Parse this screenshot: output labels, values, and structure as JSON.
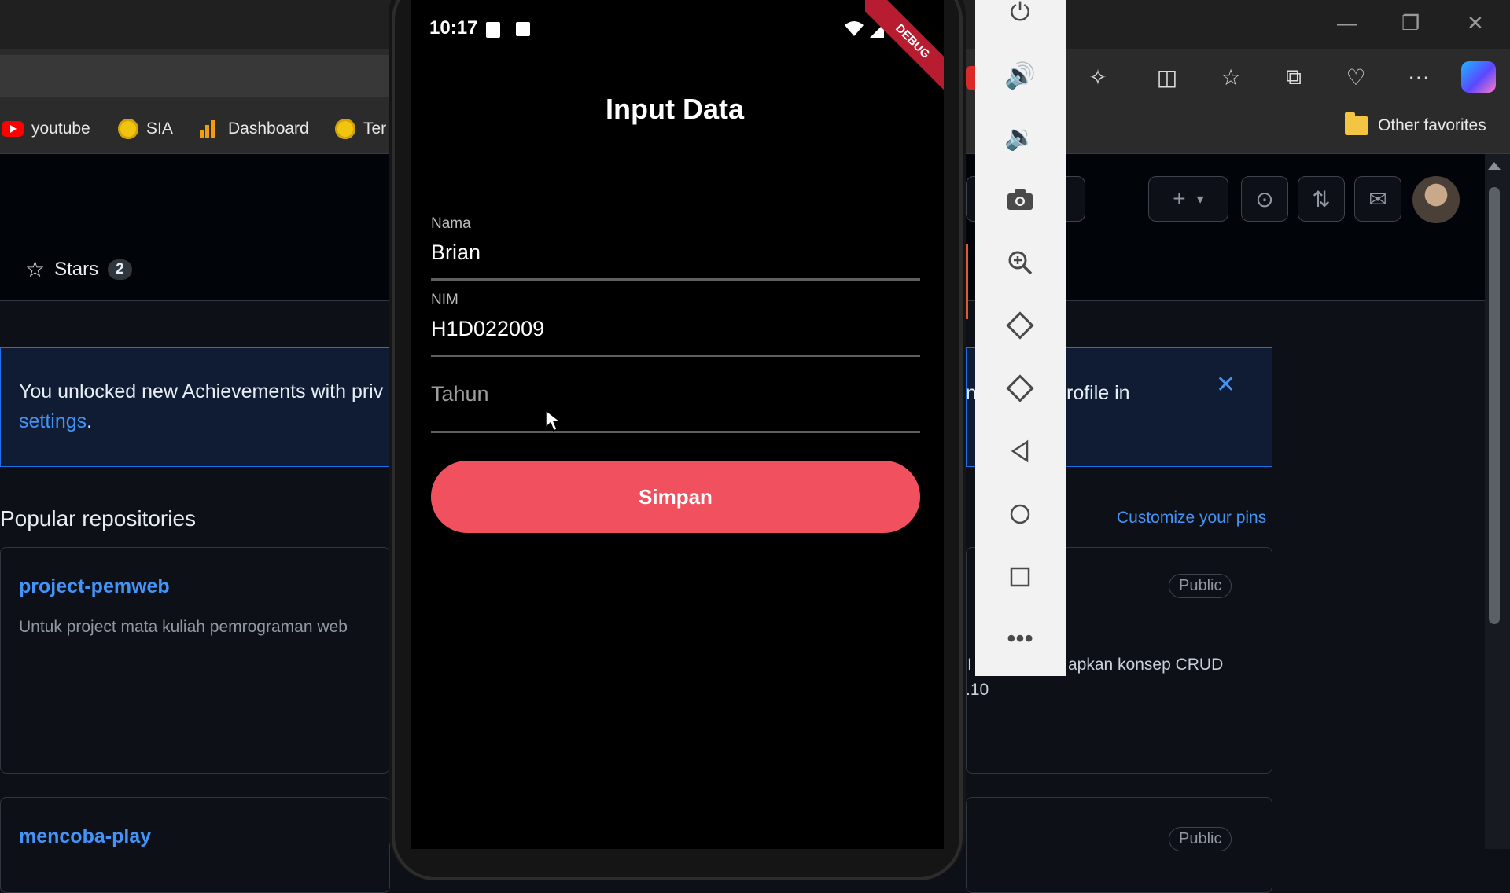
{
  "browser": {
    "bookmarks": [
      {
        "label": "youtube"
      },
      {
        "label": "SIA"
      },
      {
        "label": "Dashboard"
      },
      {
        "label": "Ter"
      }
    ],
    "other_favorites": "Other favorites"
  },
  "github": {
    "stars_label": "Stars",
    "stars_count": "2",
    "banner_line1": "You unlocked new Achievements with priv",
    "banner_link": "settings",
    "banner_dot": ".",
    "banner_right_a": "ns",
    "banner_right_b": "rofile in",
    "popular_title": "Popular repositories",
    "customize_pins": "Customize your pins",
    "repos": [
      {
        "name": "project-pemweb",
        "desc": "Untuk project mata kuliah pemrograman web"
      },
      {
        "name": "mencoba-play",
        "desc": ""
      }
    ],
    "right_card_text": "apkan konsep CRUD",
    "right_card_text2": ".10",
    "right_card_i": "I",
    "public_badge": "Public"
  },
  "phone": {
    "time": "10:17",
    "debug_banner": "DEBUG",
    "title": "Input Data",
    "fields": [
      {
        "label": "Nama",
        "value": "Brian"
      },
      {
        "label": "NIM",
        "value": "H1D022009"
      },
      {
        "label": "",
        "hint": "Tahun"
      }
    ],
    "button": "Simpan"
  },
  "emulator_toolbar": [
    "power-icon",
    "volume-up-icon",
    "volume-down-icon",
    "camera-icon",
    "zoom-in-icon",
    "rotate-left-icon",
    "rotate-right-icon",
    "back-icon",
    "home-icon",
    "overview-icon",
    "more-icon"
  ]
}
